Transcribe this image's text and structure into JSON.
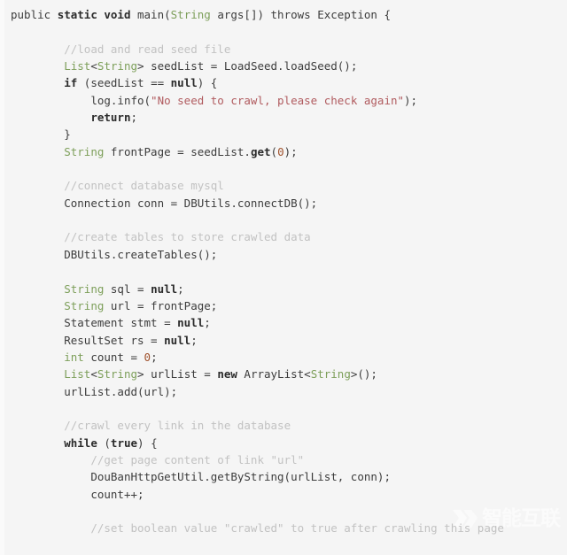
{
  "viewer": {
    "title": "Java source code snippet",
    "background_color": "#f5f5f5",
    "font_size_px": 12.5,
    "line_height_px": 19.35
  },
  "theme": {
    "plain_color": "#3c3c3c",
    "keyword_color": "#2b2b2b",
    "type_color": "#7d9f5a",
    "string_color": "#b05a5e",
    "number_color": "#a0522d",
    "comment_color": "#c2c2c2",
    "background_color": "#f5f5f5",
    "gutter_color": "#fafafa"
  },
  "watermark": {
    "text": "智能互联",
    "mark_name": "chevron-logo-mark",
    "color": "#ffffff"
  },
  "code": {
    "language": "java",
    "plain_text": "public static void main(String args[]) throws Exception {\n\n        //load and read seed file\n        List<String> seedList = LoadSeed.loadSeed();\n        if (seedList == null) {\n            log.info(\"No seed to crawl, please check again\");\n            return;\n        }\n        String frontPage = seedList.get(0);\n\n        //connect database mysql\n        Connection conn = DBUtils.connectDB();\n\n        //create tables to store crawled data\n        DBUtils.createTables();\n\n        String sql = null;\n        String url = frontPage;\n        Statement stmt = null;\n        ResultSet rs = null;\n        int count = 0;\n        List<String> urlList = new ArrayList<String>();\n        urlList.add(url);\n\n        //crawl every link in the database\n        while (true) {\n            //get page content of link \"url\"\n            DouBanHttpGetUtil.getByString(urlList, conn);\n            count++;\n\n            //set boolean value \"crawled\" to true after crawling this page",
    "lines": [
      {
        "n": 1,
        "indent": 0,
        "tokens": [
          {
            "t": "public ",
            "c": "plain"
          },
          {
            "t": "static void ",
            "c": "kw"
          },
          {
            "t": "main(",
            "c": "plain"
          },
          {
            "t": "String",
            "c": "type"
          },
          {
            "t": " args[]) throws Exception {",
            "c": "plain"
          }
        ]
      },
      {
        "n": 2,
        "indent": 0,
        "tokens": []
      },
      {
        "n": 3,
        "indent": 8,
        "tokens": [
          {
            "t": "//load and read seed file",
            "c": "comment"
          }
        ]
      },
      {
        "n": 4,
        "indent": 8,
        "tokens": [
          {
            "t": "List",
            "c": "type"
          },
          {
            "t": "<",
            "c": "plain"
          },
          {
            "t": "String",
            "c": "type"
          },
          {
            "t": "> seedList = LoadSeed.loadSeed();",
            "c": "plain"
          }
        ]
      },
      {
        "n": 5,
        "indent": 8,
        "tokens": [
          {
            "t": "if",
            "c": "kw"
          },
          {
            "t": " (seedList == ",
            "c": "plain"
          },
          {
            "t": "null",
            "c": "kw"
          },
          {
            "t": ") {",
            "c": "plain"
          }
        ]
      },
      {
        "n": 6,
        "indent": 12,
        "tokens": [
          {
            "t": "log.info(",
            "c": "plain"
          },
          {
            "t": "\"No seed to crawl, please check again\"",
            "c": "string"
          },
          {
            "t": ");",
            "c": "plain"
          }
        ]
      },
      {
        "n": 7,
        "indent": 12,
        "tokens": [
          {
            "t": "return",
            "c": "kw"
          },
          {
            "t": ";",
            "c": "plain"
          }
        ]
      },
      {
        "n": 8,
        "indent": 8,
        "tokens": [
          {
            "t": "}",
            "c": "plain"
          }
        ]
      },
      {
        "n": 9,
        "indent": 8,
        "tokens": [
          {
            "t": "String",
            "c": "type"
          },
          {
            "t": " frontPage = seedList.",
            "c": "plain"
          },
          {
            "t": "get",
            "c": "kw"
          },
          {
            "t": "(",
            "c": "plain"
          },
          {
            "t": "0",
            "c": "number"
          },
          {
            "t": ");",
            "c": "plain"
          }
        ]
      },
      {
        "n": 10,
        "indent": 0,
        "tokens": []
      },
      {
        "n": 11,
        "indent": 8,
        "tokens": [
          {
            "t": "//connect database mysql",
            "c": "comment"
          }
        ]
      },
      {
        "n": 12,
        "indent": 8,
        "tokens": [
          {
            "t": "Connection conn = DBUtils.connectDB();",
            "c": "plain"
          }
        ]
      },
      {
        "n": 13,
        "indent": 0,
        "tokens": []
      },
      {
        "n": 14,
        "indent": 8,
        "tokens": [
          {
            "t": "//create tables to store crawled data",
            "c": "comment"
          }
        ]
      },
      {
        "n": 15,
        "indent": 8,
        "tokens": [
          {
            "t": "DBUtils.createTables();",
            "c": "plain"
          }
        ]
      },
      {
        "n": 16,
        "indent": 0,
        "tokens": []
      },
      {
        "n": 17,
        "indent": 8,
        "tokens": [
          {
            "t": "String",
            "c": "type"
          },
          {
            "t": " sql = ",
            "c": "plain"
          },
          {
            "t": "null",
            "c": "kw"
          },
          {
            "t": ";",
            "c": "plain"
          }
        ]
      },
      {
        "n": 18,
        "indent": 8,
        "tokens": [
          {
            "t": "String",
            "c": "type"
          },
          {
            "t": " url = frontPage;",
            "c": "plain"
          }
        ]
      },
      {
        "n": 19,
        "indent": 8,
        "tokens": [
          {
            "t": "Statement stmt = ",
            "c": "plain"
          },
          {
            "t": "null",
            "c": "kw"
          },
          {
            "t": ";",
            "c": "plain"
          }
        ]
      },
      {
        "n": 20,
        "indent": 8,
        "tokens": [
          {
            "t": "ResultSet rs = ",
            "c": "plain"
          },
          {
            "t": "null",
            "c": "kw"
          },
          {
            "t": ";",
            "c": "plain"
          }
        ]
      },
      {
        "n": 21,
        "indent": 8,
        "tokens": [
          {
            "t": "int",
            "c": "type"
          },
          {
            "t": " count = ",
            "c": "plain"
          },
          {
            "t": "0",
            "c": "number"
          },
          {
            "t": ";",
            "c": "plain"
          }
        ]
      },
      {
        "n": 22,
        "indent": 8,
        "tokens": [
          {
            "t": "List",
            "c": "type"
          },
          {
            "t": "<",
            "c": "plain"
          },
          {
            "t": "String",
            "c": "type"
          },
          {
            "t": "> urlList = ",
            "c": "plain"
          },
          {
            "t": "new",
            "c": "kw"
          },
          {
            "t": " ArrayList<",
            "c": "plain"
          },
          {
            "t": "String",
            "c": "type"
          },
          {
            "t": ">();",
            "c": "plain"
          }
        ]
      },
      {
        "n": 23,
        "indent": 8,
        "tokens": [
          {
            "t": "urlList.add(url);",
            "c": "plain"
          }
        ]
      },
      {
        "n": 24,
        "indent": 0,
        "tokens": []
      },
      {
        "n": 25,
        "indent": 8,
        "tokens": [
          {
            "t": "//crawl every link in the database",
            "c": "comment"
          }
        ]
      },
      {
        "n": 26,
        "indent": 8,
        "tokens": [
          {
            "t": "while",
            "c": "kw"
          },
          {
            "t": " (",
            "c": "plain"
          },
          {
            "t": "true",
            "c": "kw"
          },
          {
            "t": ") {",
            "c": "plain"
          }
        ]
      },
      {
        "n": 27,
        "indent": 12,
        "tokens": [
          {
            "t": "//get page content of link \"url\"",
            "c": "comment"
          }
        ]
      },
      {
        "n": 28,
        "indent": 12,
        "tokens": [
          {
            "t": "DouBanHttpGetUtil.getByString(urlList, conn);",
            "c": "plain"
          }
        ]
      },
      {
        "n": 29,
        "indent": 12,
        "tokens": [
          {
            "t": "count++;",
            "c": "plain"
          }
        ]
      },
      {
        "n": 30,
        "indent": 0,
        "tokens": []
      },
      {
        "n": 31,
        "indent": 12,
        "tokens": [
          {
            "t": "//set boolean value \"crawled\" to true after crawling this page",
            "c": "comment"
          }
        ]
      }
    ]
  }
}
